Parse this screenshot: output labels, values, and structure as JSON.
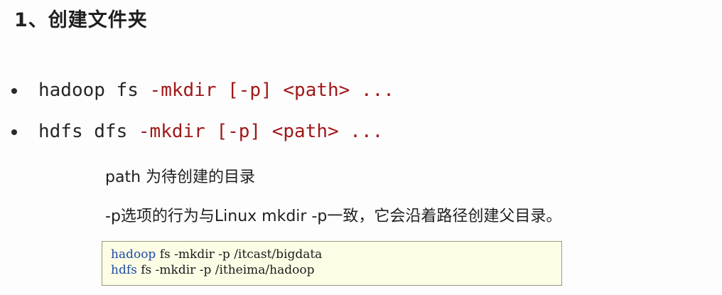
{
  "title": "1、创建文件夹",
  "bullets": [
    {
      "base": "hadoop fs ",
      "options": "-mkdir [-p] <path> ..."
    },
    {
      "base": "hdfs dfs ",
      "options": "-mkdir [-p] <path> ..."
    }
  ],
  "descriptions": [
    "path 为待创建的目录",
    "-p选项的行为与Linux mkdir -p一致，它会沿着路径创建父目录。"
  ],
  "code_example": {
    "lines": [
      {
        "keyword": "hadoop",
        "rest": " fs -mkdir -p /itcast/bigdata"
      },
      {
        "keyword": "hdfs",
        "rest": " fs -mkdir -p /itheima/hadoop"
      }
    ]
  },
  "colors": {
    "option_red": "#a11818",
    "keyword_blue": "#1f4aa8",
    "code_background": "#fdfde6"
  },
  "icons": {
    "bullet": "bullet-dot-icon"
  }
}
